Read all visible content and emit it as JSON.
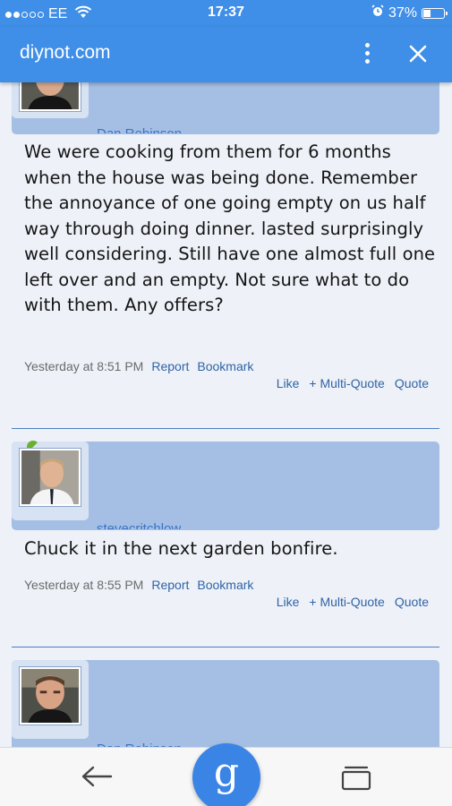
{
  "status_bar": {
    "carrier": "EE",
    "time": "17:37",
    "battery_text": "37%",
    "battery_level": 0.37,
    "signal_bars_filled": 2,
    "signal_bars_total": 5,
    "icons": [
      "wifi-icon",
      "alarm-icon",
      "battery-icon"
    ]
  },
  "app_bar": {
    "title": "diynot.com",
    "color": "#3f8ee7",
    "icons": [
      "more-vert-icon",
      "close-icon"
    ]
  },
  "posts": [
    {
      "username": "Dan Robinson",
      "message": "We were cooking from them for 6 months when the house was being done. Remember the annoyance of one going empty on us half way through doing dinner. lasted surprisingly well considering. Still have one almost full one left over and an empty. Not sure what to do with them. Any offers?",
      "date": "Yesterday at 8:51 PM",
      "report": "Report",
      "bookmark": "Bookmark",
      "like": "Like",
      "multi_quote": "+ Multi-Quote",
      "quote": "Quote"
    },
    {
      "username": "stevecritchlow",
      "message": "Chuck it in the next garden bonfire.",
      "date": "Yesterday at 8:55 PM",
      "report": "Report",
      "bookmark": "Bookmark",
      "like": "Like",
      "multi_quote": "+ Multi-Quote",
      "quote": "Quote"
    },
    {
      "username": "Dan Robinson"
    }
  ],
  "bottom_bar": {
    "google_label": "g",
    "icons": [
      "back-arrow-icon",
      "google-g-icon",
      "tabs-icon"
    ]
  }
}
